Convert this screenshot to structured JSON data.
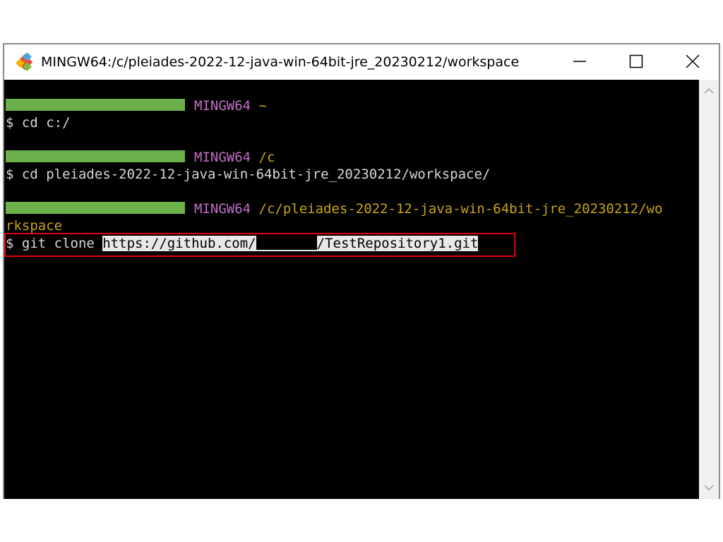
{
  "window": {
    "title": "MINGW64:/c/pleiades-2022-12-java-win-64bit-jre_20230212/workspace",
    "app_icon": "git-bash-icon",
    "controls": {
      "minimize": "minimize-icon",
      "maximize": "maximize-icon",
      "close": "close-icon"
    }
  },
  "terminal": {
    "colors": {
      "background": "#000000",
      "text": "#d8d8d8",
      "user": "#6cb04b",
      "host": "#c26ec6",
      "path": "#c7a414",
      "highlight": "#e00000"
    },
    "prompts": [
      {
        "host": "MINGW64",
        "path": "~"
      },
      {
        "host": "MINGW64",
        "path": "/c"
      },
      {
        "host": "MINGW64",
        "path_line1": "/c/pleiades-2022-12-java-win-64bit-jre_20230212/wo",
        "path_line2": "rkspace"
      }
    ],
    "commands": [
      "$ cd c:/",
      "$ cd pleiades-2022-12-java-win-64bit-jre_20230212/workspace/"
    ],
    "clone_command": {
      "prefix": "$ git clone ",
      "url_start": "https://github.com/",
      "url_end": "/TestRepository1.git"
    }
  }
}
